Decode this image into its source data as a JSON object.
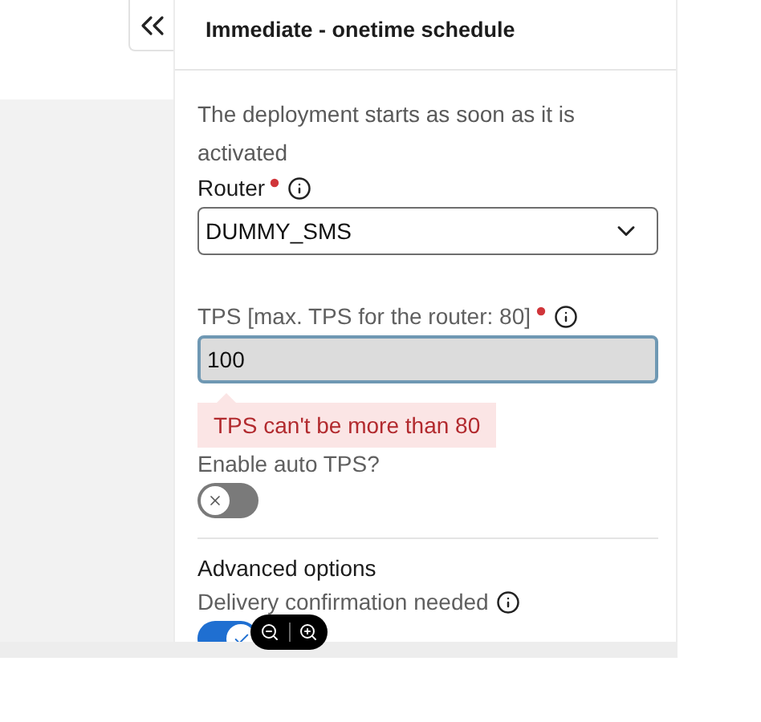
{
  "panel": {
    "title": "Immediate - onetime schedule",
    "description": "The deployment starts as soon as it is activated",
    "fields": [
      {
        "kind": "select",
        "label": "Router",
        "required": true,
        "info": true,
        "value": "DUMMY_SMS"
      },
      {
        "kind": "input",
        "label": "TPS [max. TPS for the router: 80]",
        "required": true,
        "info": true,
        "value": "100",
        "error": "TPS can't be more than 80"
      },
      {
        "kind": "toggle",
        "label": "Enable auto TPS?",
        "info": false,
        "on": false
      }
    ],
    "section": {
      "title": "Advanced options",
      "fields": [
        {
          "kind": "toggle",
          "label": "Delivery confirmation needed",
          "info": true,
          "on": true
        }
      ]
    }
  }
}
